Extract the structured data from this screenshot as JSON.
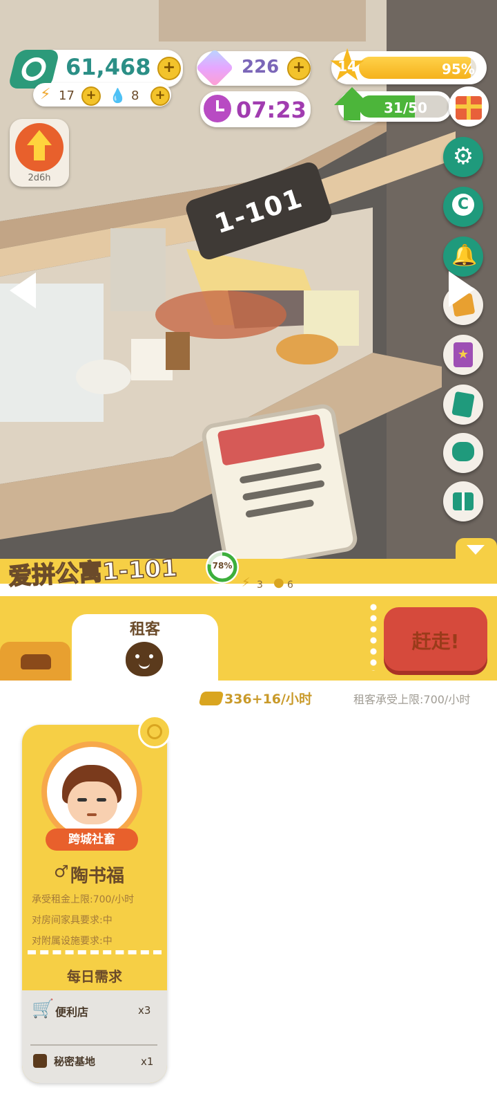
{
  "hud": {
    "coins": "61,468",
    "energy": "17",
    "water": "8",
    "gems": "226",
    "timer": "07:23",
    "level": "14",
    "level_progress_text": "95%",
    "level_progress": 0.95,
    "upgrade_count": "31/50",
    "upgrade_progress": 0.62,
    "boost_timer": "2d6h"
  },
  "room": {
    "sign": "1-101",
    "title": "爱拼公寓1-101",
    "occupancy": "78%",
    "occupancy_value": 0.78,
    "energy_cost": "3",
    "water_cost": "6"
  },
  "tabs": {
    "tenant_label": "租客",
    "evict_label": "赶走!"
  },
  "stats": {
    "income": "336+16/小时",
    "rent_limit": "租客承受上限:700/小时"
  },
  "tenant": {
    "tag": "跨城社畜",
    "gender_symbol": "♂",
    "name": "陶书福",
    "rent_cap": "承受租金上限:700/小时",
    "furniture_req": "对房间家具要求:中",
    "facility_req": "对附属设施要求:中",
    "daily_title": "每日需求",
    "needs": [
      {
        "label": "便利店",
        "count": "x3"
      },
      {
        "label": "秘密基地",
        "count": "x1"
      }
    ]
  },
  "colors": {
    "yellow": "#f6cf45",
    "red_button": "#d64a3c",
    "brown": "#6b4b2a",
    "teal": "#1f9a7c"
  }
}
